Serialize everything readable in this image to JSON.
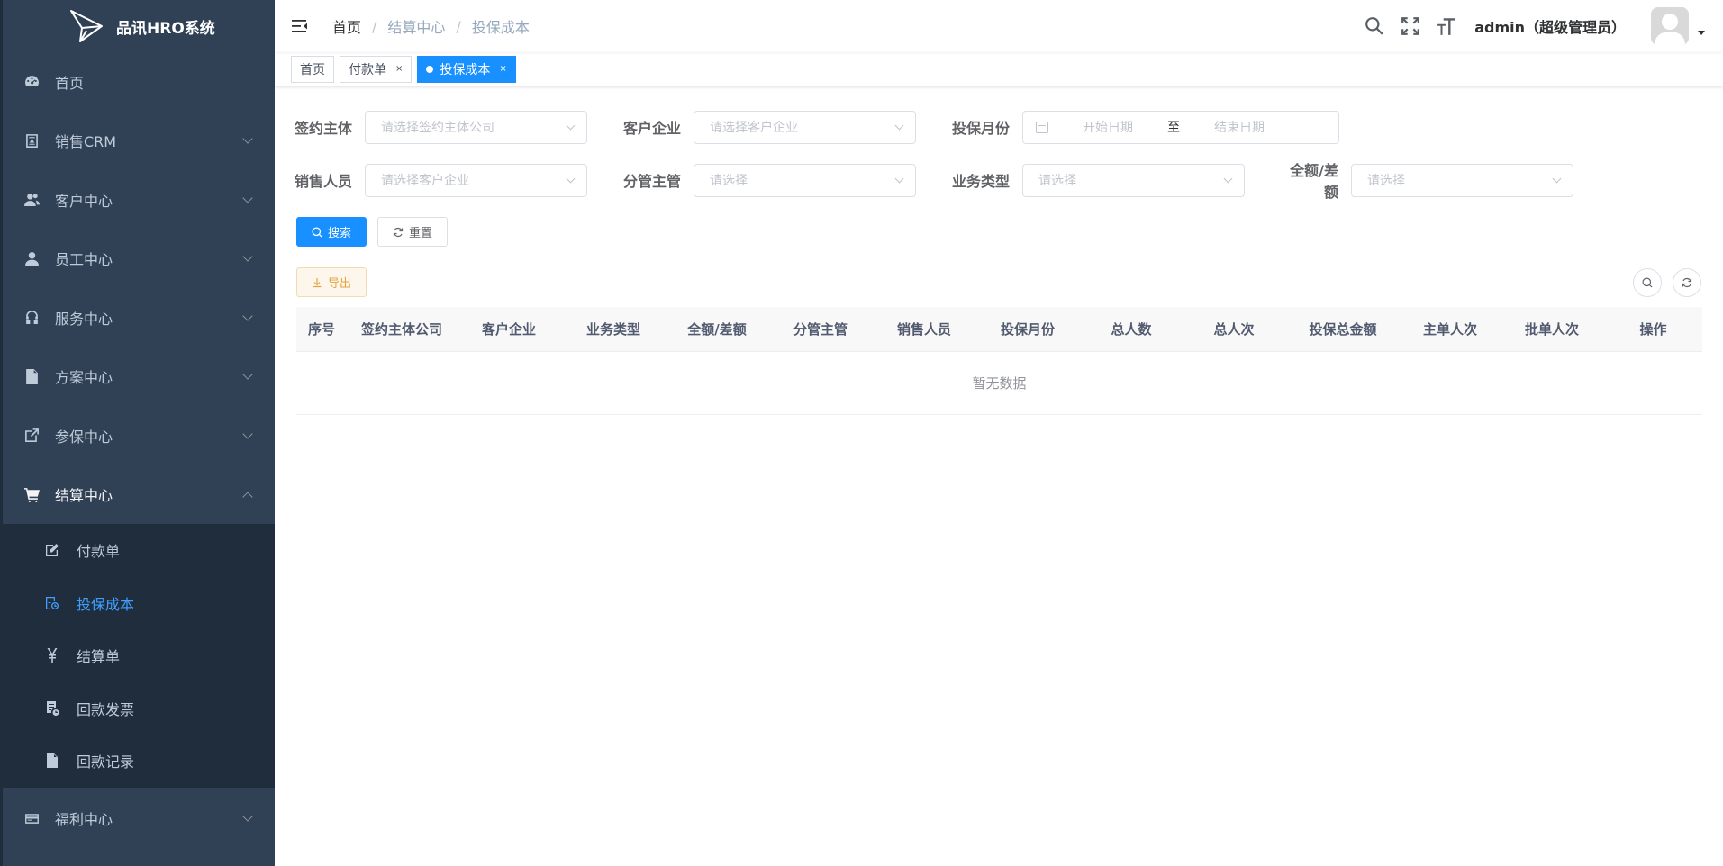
{
  "app": {
    "title": "品讯HRO系统"
  },
  "sidebar": {
    "items": [
      {
        "label": "首页",
        "icon": "dashboard-icon",
        "has_children": false
      },
      {
        "label": "销售CRM",
        "icon": "crm-icon",
        "has_children": true
      },
      {
        "label": "客户中心",
        "icon": "peoples-icon",
        "has_children": true
      },
      {
        "label": "员工中心",
        "icon": "user-icon",
        "has_children": true
      },
      {
        "label": "服务中心",
        "icon": "service-icon",
        "has_children": true
      },
      {
        "label": "方案中心",
        "icon": "document-icon",
        "has_children": true
      },
      {
        "label": "参保中心",
        "icon": "external-link-icon",
        "has_children": true
      },
      {
        "label": "结算中心",
        "icon": "cart-icon",
        "has_children": true,
        "open": true
      }
    ],
    "settlement_children": [
      {
        "label": "付款单",
        "icon": "edit-icon"
      },
      {
        "label": "投保成本",
        "icon": "cost-icon",
        "active": true
      },
      {
        "label": "结算单",
        "icon": "yen-icon"
      },
      {
        "label": "回款发票",
        "icon": "invoice-icon"
      },
      {
        "label": "回款记录",
        "icon": "record-icon"
      }
    ],
    "after_items": [
      {
        "label": "福利中心",
        "icon": "welfare-icon",
        "has_children": true
      }
    ]
  },
  "navbar": {
    "breadcrumb": [
      "首页",
      "结算中心",
      "投保成本"
    ],
    "separator": "/",
    "username": "admin（超级管理员）"
  },
  "tags": [
    {
      "label": "首页",
      "closable": false,
      "active": false
    },
    {
      "label": "付款单",
      "closable": true,
      "active": false
    },
    {
      "label": "投保成本",
      "closable": true,
      "active": true
    }
  ],
  "tag_close": "×",
  "filters": {
    "signing_entity": {
      "label": "签约主体",
      "placeholder": "请选择签约主体公司"
    },
    "customer": {
      "label": "客户企业",
      "placeholder": "请选择客户企业"
    },
    "month": {
      "label": "投保月份",
      "start_placeholder": "开始日期",
      "separator": "至",
      "end_placeholder": "结束日期"
    },
    "salesperson": {
      "label": "销售人员",
      "placeholder": "请选择客户企业"
    },
    "branch_manager": {
      "label": "分管主管",
      "placeholder": "请选择"
    },
    "business_type": {
      "label": "业务类型",
      "placeholder": "请选择"
    },
    "full_diff": {
      "label": "全额/差额",
      "placeholder": "请选择"
    }
  },
  "buttons": {
    "search": "搜索",
    "reset": "重置",
    "export": "导出"
  },
  "table": {
    "columns": [
      "序号",
      "签约主体公司",
      "客户企业",
      "业务类型",
      "全额/差额",
      "分管主管",
      "销售人员",
      "投保月份",
      "总人数",
      "总人次",
      "投保总金额",
      "主单人次",
      "批单人次",
      "操作"
    ],
    "empty_text": "暂无数据"
  },
  "colors": {
    "sidebar_bg": "#304156",
    "submenu_bg": "#1f2d3d",
    "primary": "#1890ff",
    "active_text": "#409eff"
  }
}
